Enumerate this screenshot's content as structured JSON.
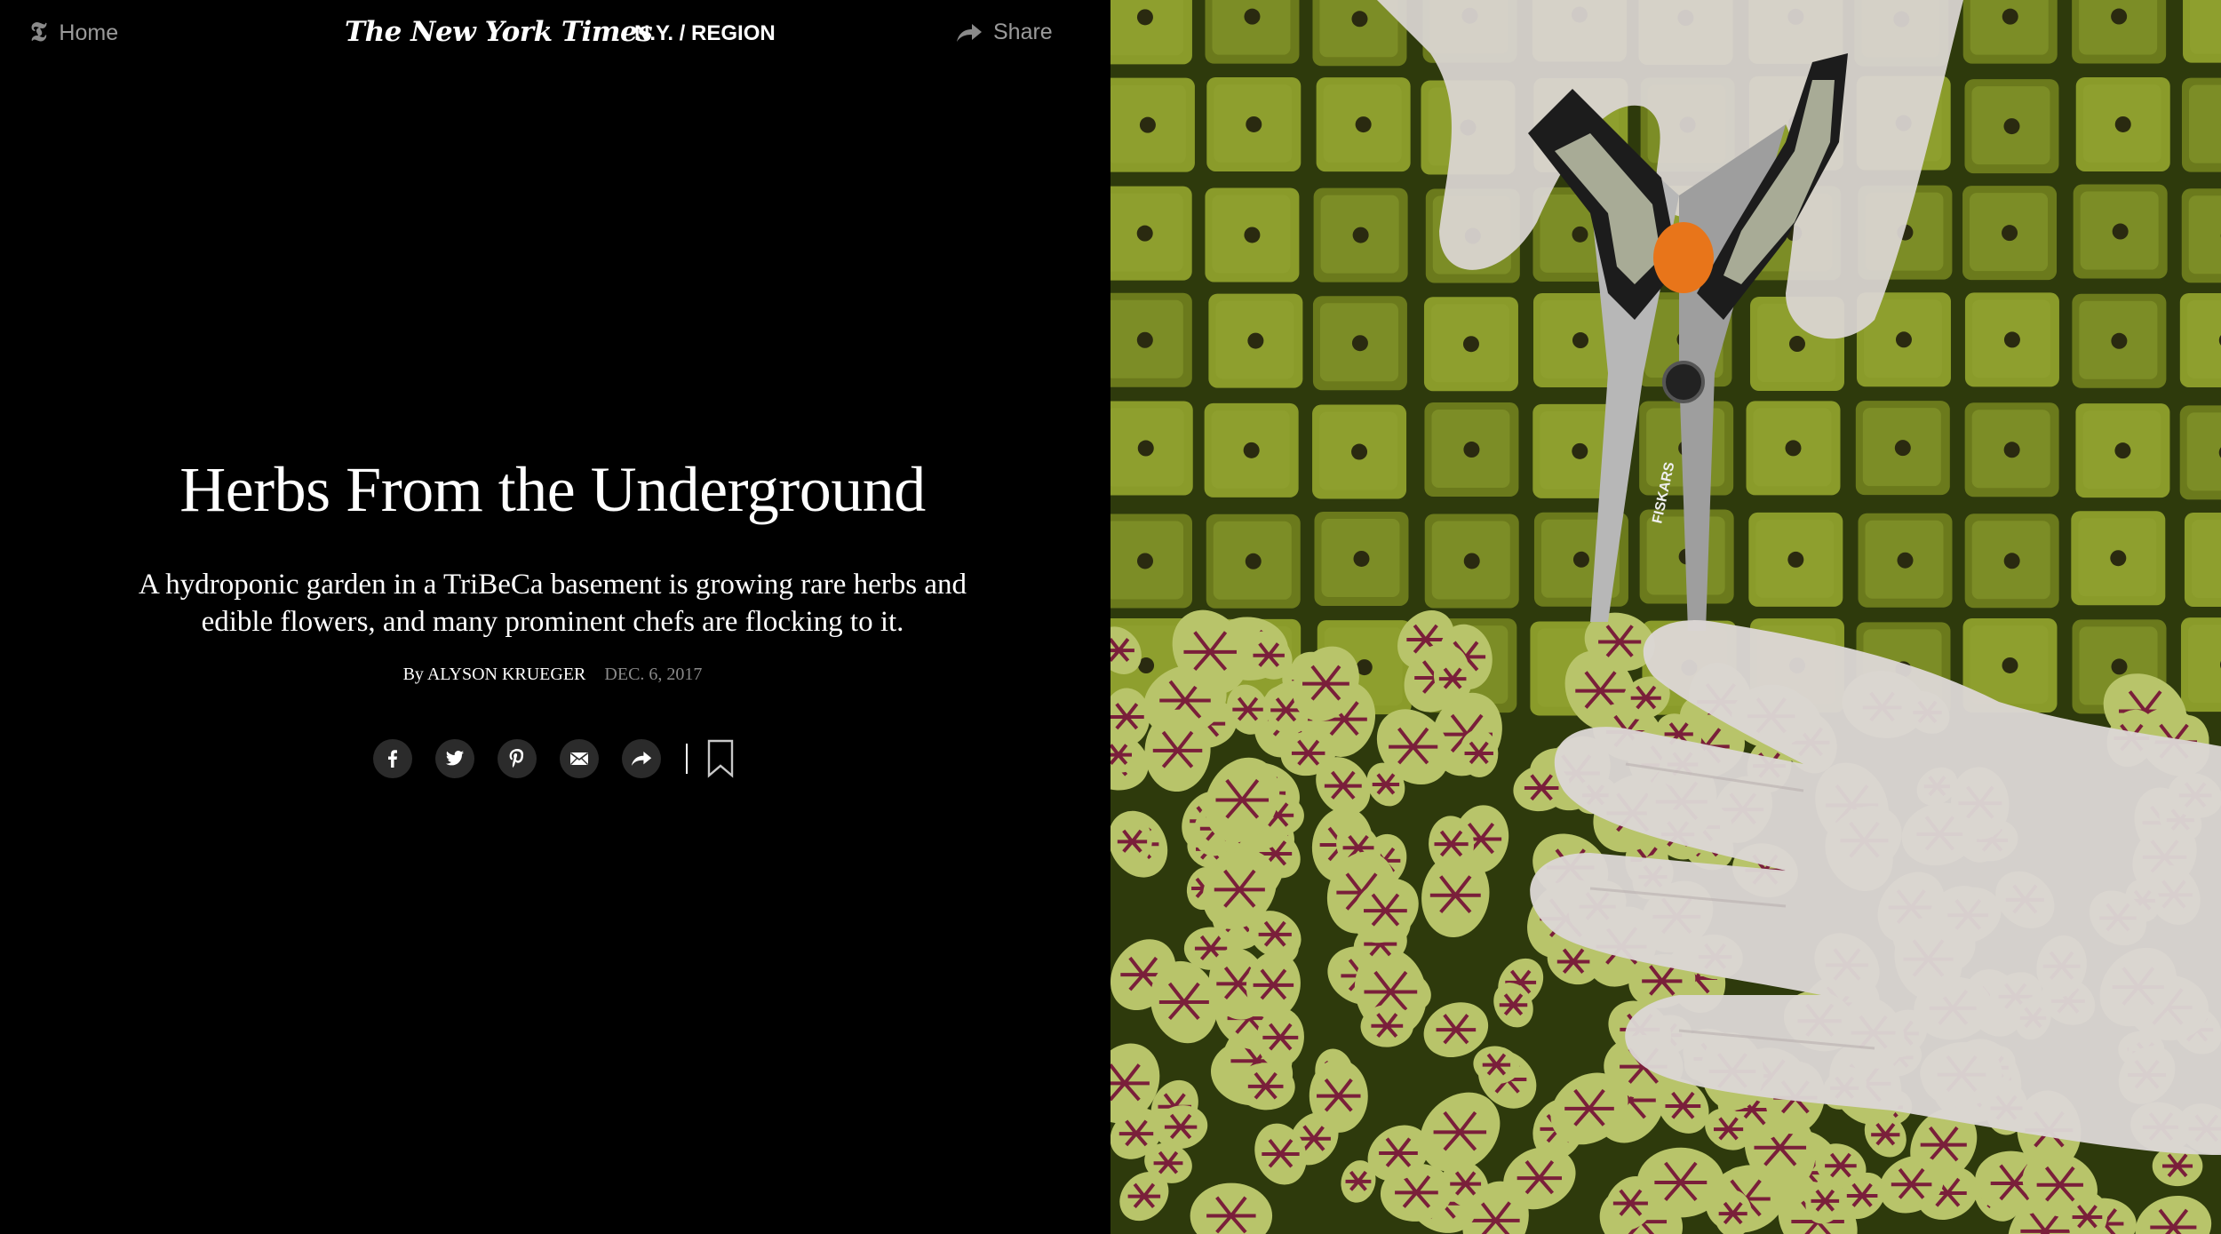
{
  "header": {
    "home_label": "Home",
    "logo_text": "The New York Times",
    "section_label": "N.Y. / REGION",
    "share_label": "Share"
  },
  "article": {
    "headline": "Herbs From the Underground",
    "dek": "A hydroponic garden in a TriBeCa basement is growing rare herbs and edible flowers, and many prominent chefs are flocking to it.",
    "byline_prefix": "By",
    "author": "ALYSON KRUEGER",
    "date": "DEC. 6, 2017"
  },
  "social": {
    "buttons": [
      "facebook-icon",
      "twitter-icon",
      "pinterest-icon",
      "email-icon",
      "share-icon"
    ],
    "bookmark": "bookmark-icon"
  },
  "photo": {
    "scissors_brand": "FISKARS",
    "colors": {
      "moss": "#6b7a1c",
      "moss_light": "#8a9b2a",
      "leaf": "#b8c46a",
      "vein": "#7a1f3a",
      "glove": "#dcd6d4",
      "handle": "#1c1c1c",
      "accent": "#e8751a"
    }
  }
}
